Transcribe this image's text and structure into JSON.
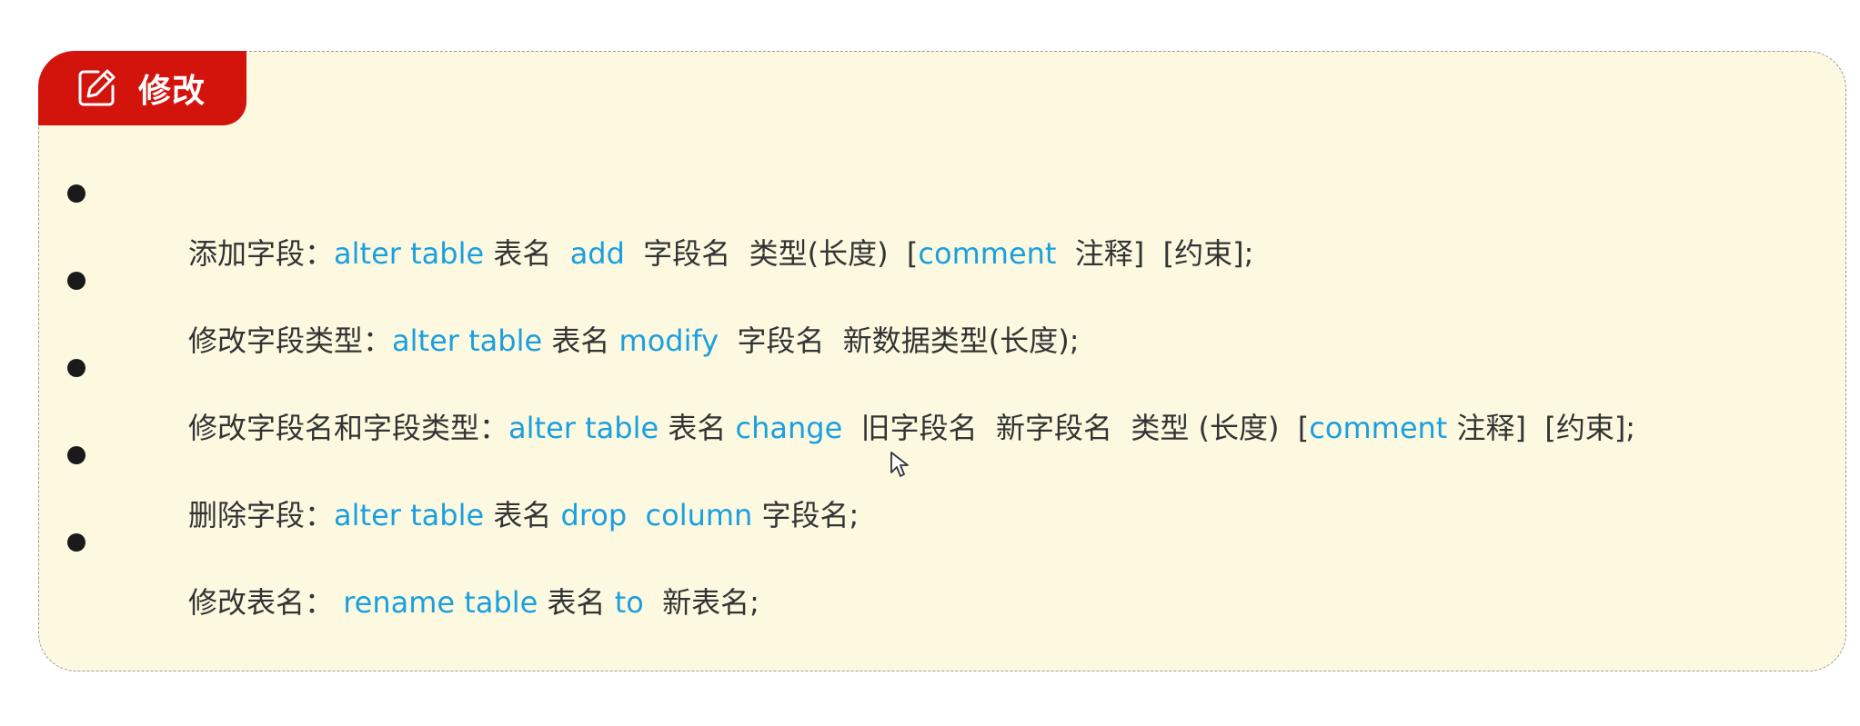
{
  "section": {
    "title": "修改",
    "icon": "edit-icon"
  },
  "colors": {
    "tag_background": "#d2140c",
    "card_background": "#fdf9e1",
    "keyword": "#1a9fe0",
    "text": "#333333"
  },
  "items": [
    {
      "segments": [
        {
          "text": "添加字段：",
          "kind": "text"
        },
        {
          "text": "alter table",
          "kind": "keyword"
        },
        {
          "text": " 表名  ",
          "kind": "text"
        },
        {
          "text": "add",
          "kind": "keyword"
        },
        {
          "text": "  字段名  类型(长度)  [",
          "kind": "text"
        },
        {
          "text": "comment",
          "kind": "keyword"
        },
        {
          "text": "  注释]  [约束];",
          "kind": "text"
        }
      ]
    },
    {
      "segments": [
        {
          "text": "修改字段类型：",
          "kind": "text"
        },
        {
          "text": "alter table",
          "kind": "keyword"
        },
        {
          "text": " 表名 ",
          "kind": "text"
        },
        {
          "text": "modify",
          "kind": "keyword"
        },
        {
          "text": "  字段名  新数据类型(长度);",
          "kind": "text"
        }
      ]
    },
    {
      "segments": [
        {
          "text": "修改字段名和字段类型：",
          "kind": "text"
        },
        {
          "text": "alter table",
          "kind": "keyword"
        },
        {
          "text": " 表名 ",
          "kind": "text"
        },
        {
          "text": "change",
          "kind": "keyword"
        },
        {
          "text": "  旧字段名  新字段名  类型 (长度)  [",
          "kind": "text"
        },
        {
          "text": "comment",
          "kind": "keyword"
        },
        {
          "text": " 注释]  [约束];",
          "kind": "text"
        }
      ]
    },
    {
      "segments": [
        {
          "text": "删除字段：",
          "kind": "text"
        },
        {
          "text": "alter table",
          "kind": "keyword"
        },
        {
          "text": " 表名 ",
          "kind": "text"
        },
        {
          "text": "drop  column",
          "kind": "keyword"
        },
        {
          "text": " 字段名;",
          "kind": "text"
        }
      ]
    },
    {
      "segments": [
        {
          "text": "修改表名： ",
          "kind": "text"
        },
        {
          "text": "rename table",
          "kind": "keyword"
        },
        {
          "text": " 表名 ",
          "kind": "text"
        },
        {
          "text": "to",
          "kind": "keyword"
        },
        {
          "text": "  新表名;",
          "kind": "text"
        }
      ]
    }
  ]
}
